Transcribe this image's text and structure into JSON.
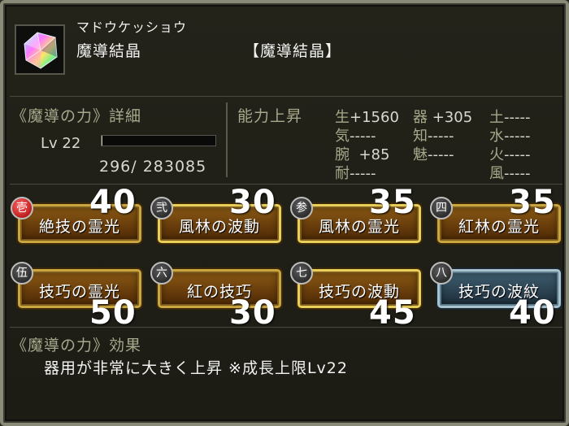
{
  "item": {
    "furigana": "マドウケッショウ",
    "name": "魔導結晶",
    "bracket_name": "【魔導結晶】",
    "icon": "crystal-icon"
  },
  "detail": {
    "title": "《魔導の力》詳細",
    "lv_label": "Lv 22",
    "xp_text": "296/  283085",
    "xp_fraction": 0.001
  },
  "ability": {
    "title": "能力上昇",
    "stats": [
      {
        "k": "生",
        "v": "+1560"
      },
      {
        "k": "気",
        "v": "-----"
      },
      {
        "k": "腕",
        "v": "  +85"
      },
      {
        "k": "耐",
        "v": "-----"
      },
      {
        "k": "器",
        "v": " +305"
      },
      {
        "k": "知",
        "v": "-----"
      },
      {
        "k": "魅",
        "v": "-----"
      },
      {
        "k": "土",
        "v": "-----"
      },
      {
        "k": "水",
        "v": "-----"
      },
      {
        "k": "火",
        "v": "-----"
      },
      {
        "k": "風",
        "v": "-----"
      }
    ]
  },
  "skills": [
    {
      "badge": "壱",
      "name": "絶技の霊光",
      "value": "40"
    },
    {
      "badge": "弐",
      "name": "風林の波動",
      "value": "30"
    },
    {
      "badge": "参",
      "name": "風林の霊光",
      "value": "35"
    },
    {
      "badge": "四",
      "name": "紅林の霊光",
      "value": "35"
    },
    {
      "badge": "伍",
      "name": "技巧の霊光",
      "value": "50"
    },
    {
      "badge": "六",
      "name": "紅の技巧",
      "value": "30"
    },
    {
      "badge": "七",
      "name": "技巧の波動",
      "value": "45"
    },
    {
      "badge": "八",
      "name": "技巧の波紋",
      "value": "40"
    }
  ],
  "effect": {
    "title": "《魔導の力》効果",
    "text": "器用が非常に大きく上昇 ※成長上限Lv22"
  },
  "colors": {
    "label": "#a8a88c",
    "text": "#f2f2f2",
    "skill_gold": "#c9a640",
    "skill_blue": "#a9c2cf",
    "badge_red": "#d40000"
  }
}
